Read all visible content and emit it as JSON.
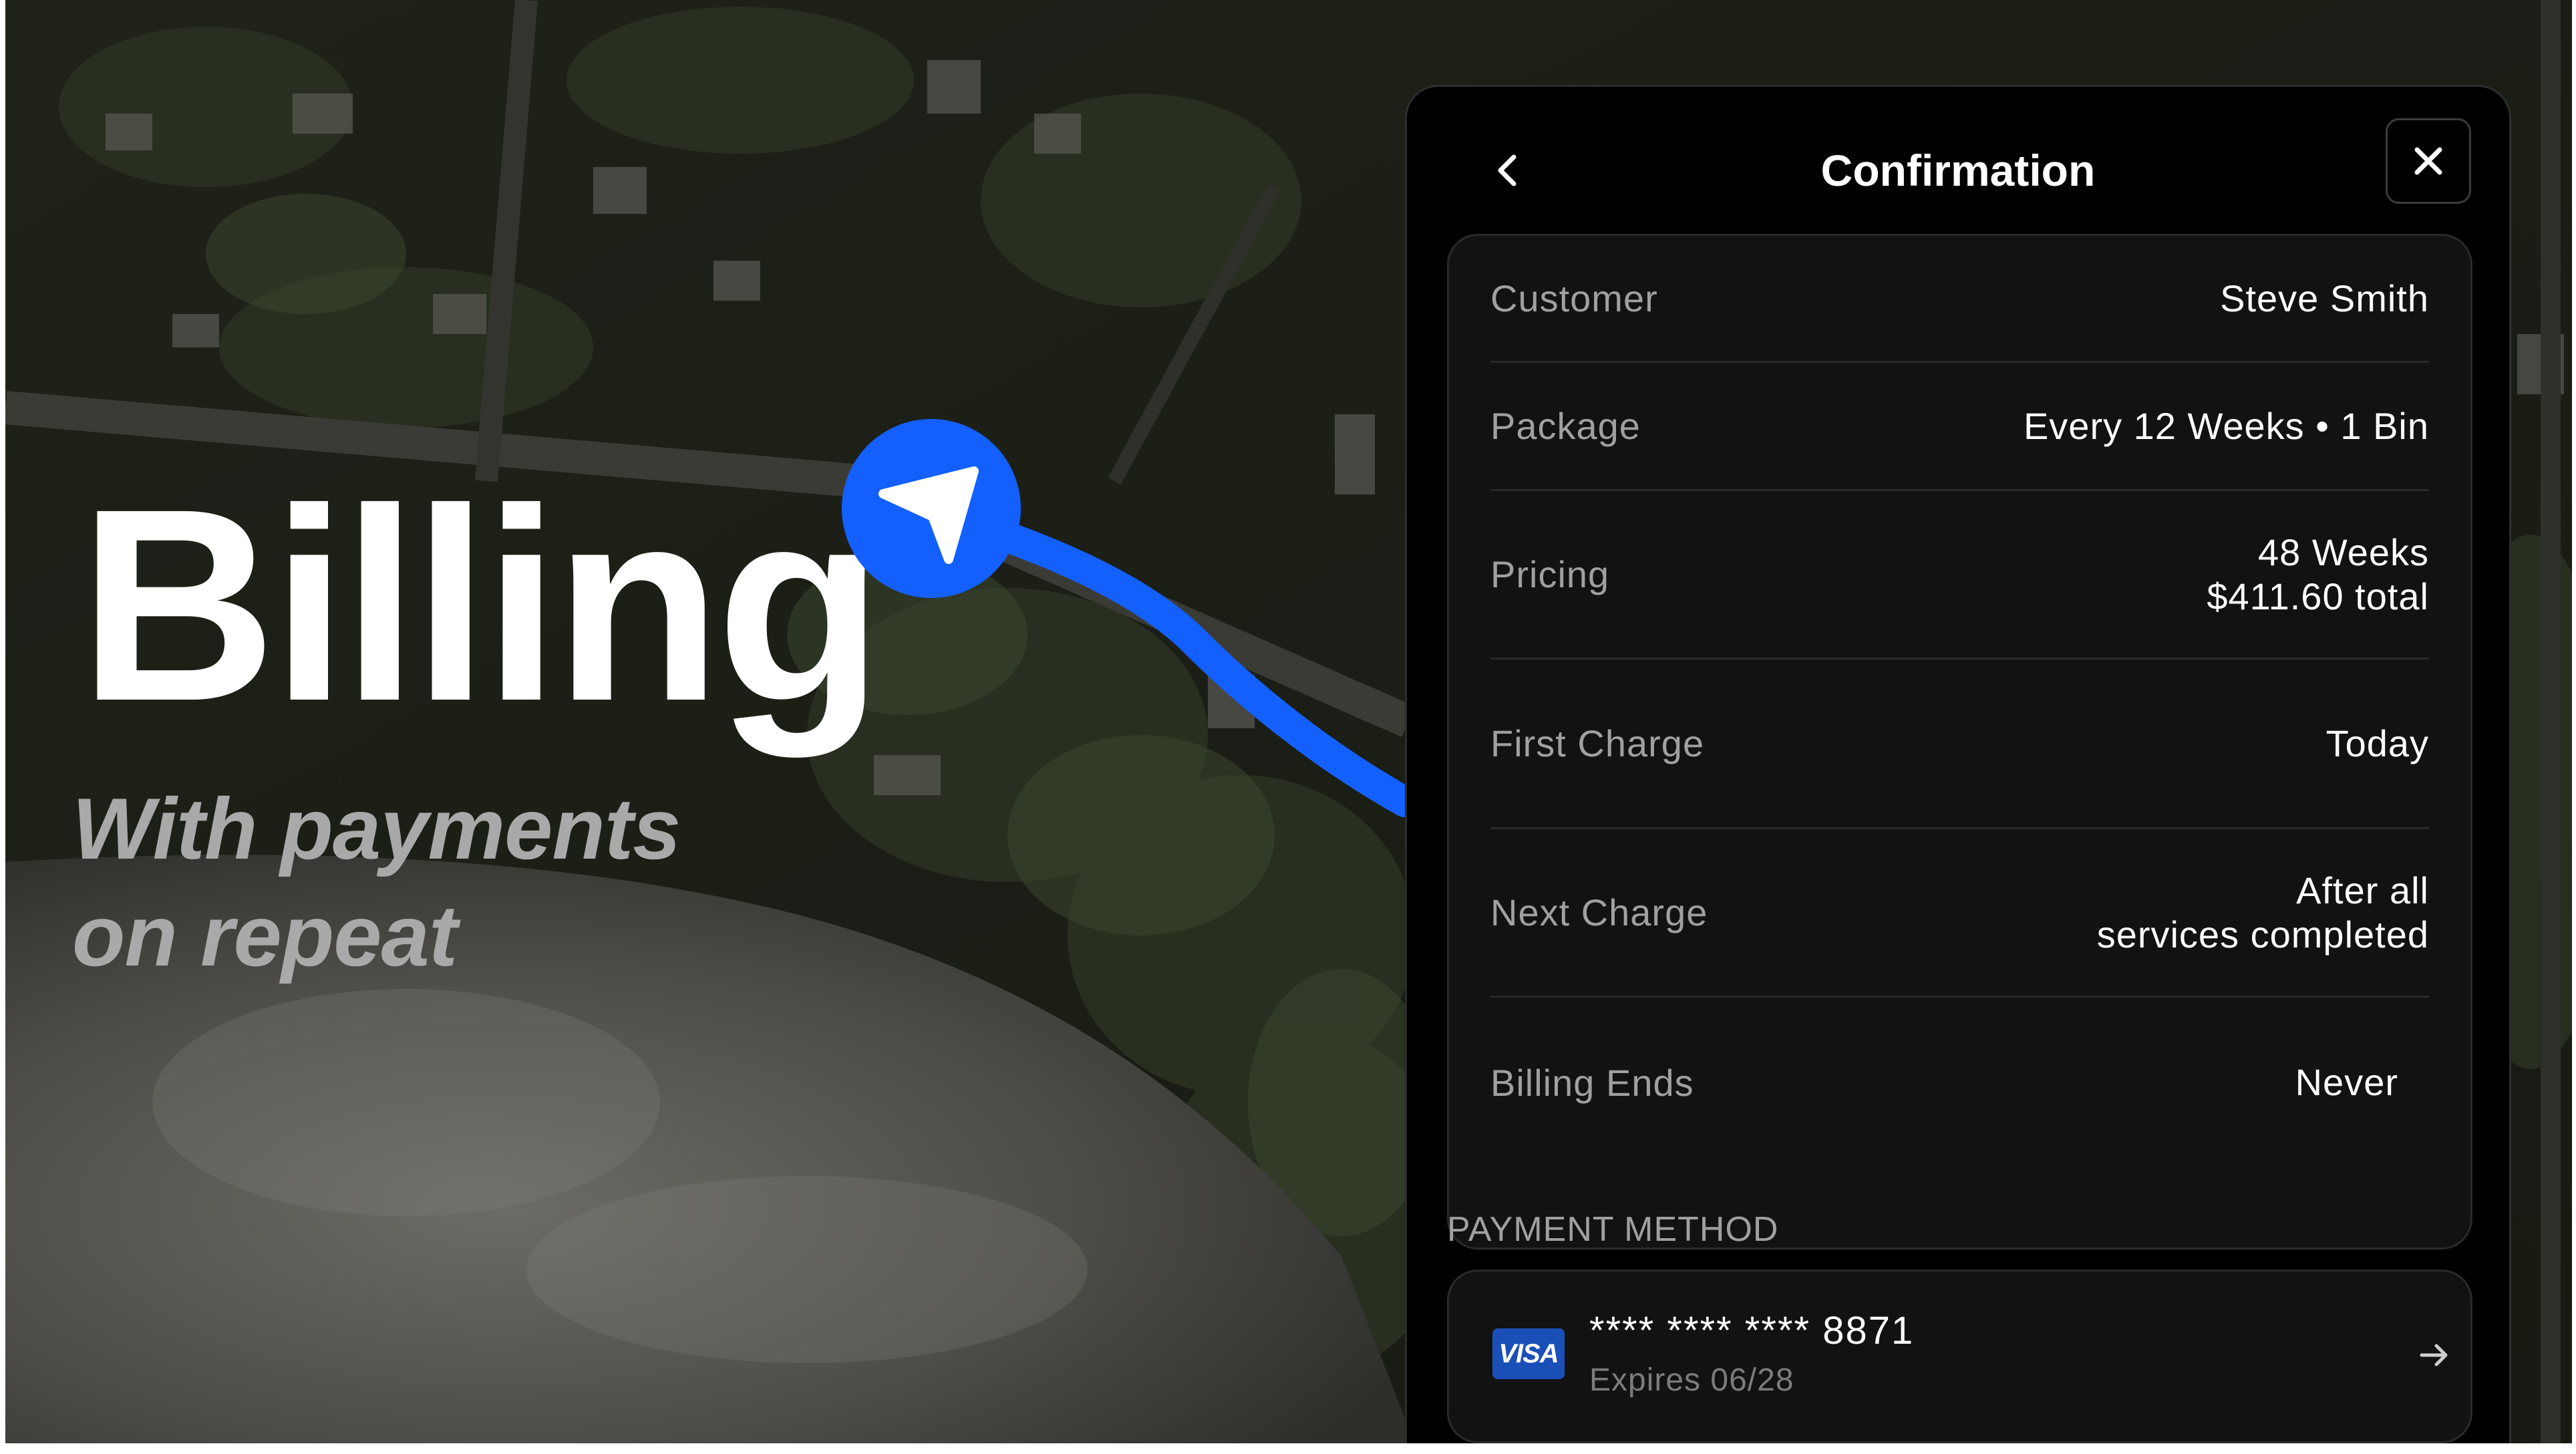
{
  "hero": {
    "title": "Billing",
    "subtitle_line1": "With payments",
    "subtitle_line2": "on repeat"
  },
  "colors": {
    "accent": "#1360ff",
    "panel_bg": "#000000",
    "card_bg": "#121212",
    "label": "#a0a0a0",
    "visa_blue": "#1a4fb8"
  },
  "panel": {
    "title": "Confirmation",
    "back_icon": "chevron-left-icon",
    "close_icon": "close-icon"
  },
  "summary": {
    "customer": {
      "label": "Customer",
      "value": "Steve Smith"
    },
    "package": {
      "label": "Package",
      "value": "Every 12 Weeks • 1 Bin"
    },
    "pricing": {
      "label": "Pricing",
      "value_line1": "48 Weeks",
      "value_line2": "$411.60 total"
    },
    "first_charge": {
      "label": "First Charge",
      "value": "Today"
    },
    "next_charge": {
      "label": "Next Charge",
      "value_line1": "After all",
      "value_line2": "services completed"
    },
    "billing_ends": {
      "label": "Billing Ends",
      "value": "Never"
    }
  },
  "payment_method": {
    "heading": "PAYMENT METHOD",
    "brand": "VISA",
    "card_number": "**** **** **** 8871",
    "expiry": "Expires 06/28",
    "arrow_icon": "arrow-right-icon"
  }
}
